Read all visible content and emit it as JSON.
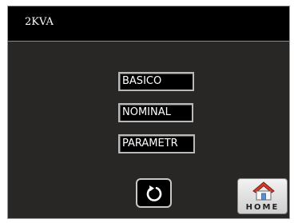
{
  "header": {
    "title": "2KVA"
  },
  "menu": {
    "items": [
      {
        "label": "BASICO"
      },
      {
        "label": "NOMINAL"
      },
      {
        "label": "PARAMETR"
      }
    ]
  },
  "controls": {
    "refresh_icon": "refresh-icon",
    "home_icon": "home-icon",
    "home_label": "HOME"
  },
  "colors": {
    "background": "#282726",
    "title_bar": "#000000",
    "button_border": "#b9b9b9",
    "home_roof": "#d83a2a"
  }
}
